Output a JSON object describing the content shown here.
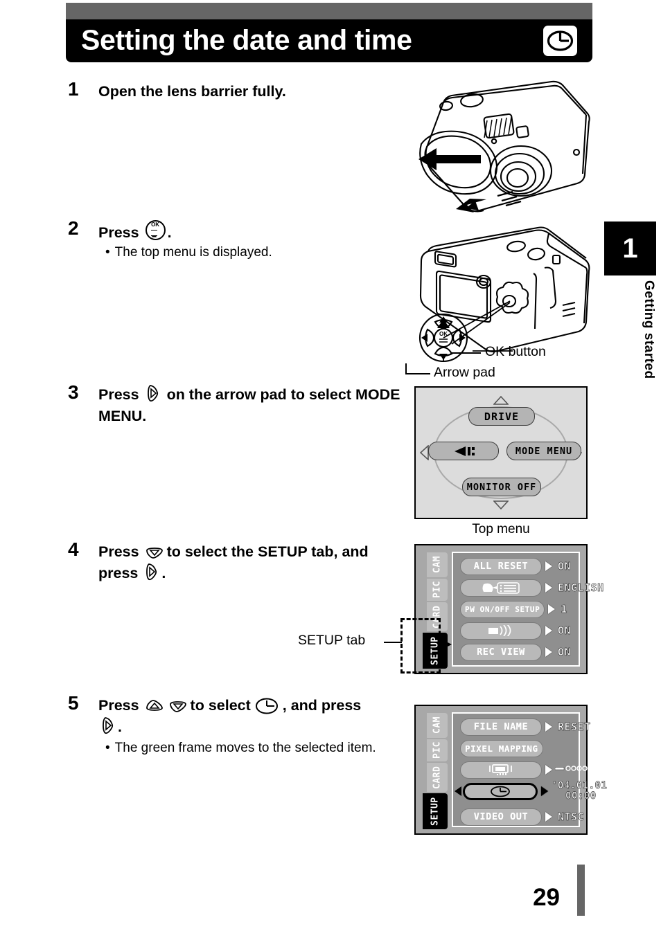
{
  "header": {
    "title": "Setting the date and time",
    "icon": "clock-icon"
  },
  "side_tab": {
    "chapter_number": "1",
    "chapter_label": "Getting started"
  },
  "steps": [
    {
      "number": "1",
      "text": "Open the lens barrier fully."
    },
    {
      "number": "2",
      "text_before": "Press",
      "icon": "ok-button-icon",
      "text_after": ".",
      "note_bullet": "•",
      "note": "The top menu is displayed."
    },
    {
      "number": "3",
      "text_before": "Press",
      "icon": "arrow-right-icon",
      "text_after": "on the arrow pad to select MODE MENU."
    },
    {
      "number": "4",
      "text_before": "Press",
      "icon1": "arrow-down-icon",
      "text_mid": "to select the SETUP tab, and press",
      "icon2": "arrow-right-icon",
      "text_after": "."
    },
    {
      "number": "5",
      "text_before": "Press",
      "icon1": "arrow-up-icon",
      "icon2": "arrow-down-icon",
      "text_mid": "to select",
      "icon3": "clock-icon",
      "text_after": ", and press",
      "icon4": "arrow-right-icon",
      "text_end": ".",
      "note_bullet": "•",
      "note": "The green frame moves to the selected item."
    }
  ],
  "illustrations": {
    "camera_front": "camera-front-lens-barrier-illustration",
    "camera_back": "camera-back-illustration",
    "callout_ok_button": "OK button",
    "callout_arrow_pad": "Arrow pad"
  },
  "top_menu": {
    "caption": "Top menu",
    "items": {
      "top": "DRIVE",
      "left_icon": "flash-mode-icon",
      "right": "MODE MENU",
      "bottom": "MONITOR OFF"
    }
  },
  "setup_menu_step4": {
    "tabs": [
      "CAM",
      "PIC",
      "CARD",
      "SETUP"
    ],
    "active_tab": "SETUP",
    "callout_label": "SETUP tab",
    "rows": [
      {
        "label": "ALL  RESET",
        "icon": "",
        "value": "ON"
      },
      {
        "label": "",
        "icon": "language-speech-icon",
        "value": "ENGLISH"
      },
      {
        "label": "PW ON/OFF SETUP",
        "icon": "",
        "value": "1"
      },
      {
        "label": "",
        "icon": "beep-sound-icon",
        "value": "ON"
      },
      {
        "label": "REC  VIEW",
        "icon": "",
        "value": "ON"
      }
    ]
  },
  "setup_menu_step5": {
    "tabs": [
      "CAM",
      "PIC",
      "CARD",
      "SETUP"
    ],
    "active_tab": "SETUP",
    "rows": [
      {
        "label": "FILE  NAME",
        "icon": "",
        "value": "RESET"
      },
      {
        "label": "PIXEL MAPPING",
        "icon": "",
        "value": ""
      },
      {
        "label": "",
        "icon": "monitor-brightness-icon",
        "value": "slider"
      },
      {
        "label": "",
        "icon": "clock-icon",
        "value_date": "'04.01.01",
        "value_time": "00:00",
        "selected": true
      },
      {
        "label": "VIDEO OUT",
        "icon": "",
        "value": "NTSC"
      }
    ]
  },
  "footer": {
    "page_number": "29"
  },
  "colors": {
    "header_gray": "#666666",
    "header_black": "#000000",
    "lcd_bg": "#dcdcdc",
    "menu_bg": "#a8a8a8",
    "menu_inner": "#8f8f8f",
    "pill": "#b9b9b9"
  }
}
